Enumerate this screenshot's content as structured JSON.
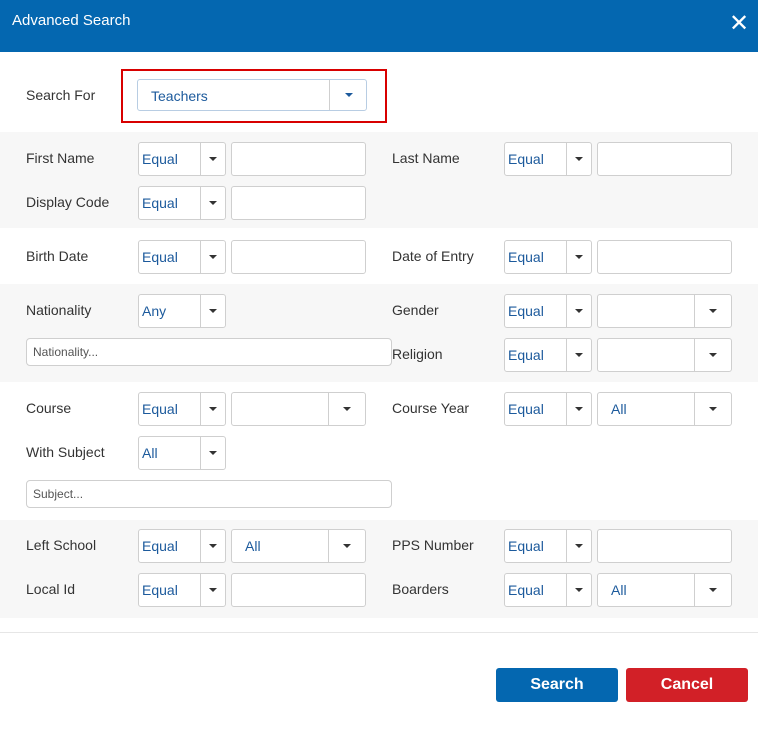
{
  "dialog": {
    "title": "Advanced Search",
    "close_glyph": "✕"
  },
  "search_for": {
    "label": "Search For",
    "value": "Teachers"
  },
  "fields": {
    "first_name": {
      "label": "First Name",
      "operator": "Equal"
    },
    "last_name": {
      "label": "Last Name",
      "operator": "Equal"
    },
    "display_code": {
      "label": "Display Code",
      "operator": "Equal"
    },
    "birth_date": {
      "label": "Birth Date",
      "operator": "Equal"
    },
    "date_of_entry": {
      "label": "Date of Entry",
      "operator": "Equal"
    },
    "nationality": {
      "label": "Nationality",
      "operator": "Any",
      "placeholder": "Nationality..."
    },
    "gender": {
      "label": "Gender",
      "operator": "Equal",
      "value": ""
    },
    "religion": {
      "label": "Religion",
      "operator": "Equal",
      "value": ""
    },
    "course": {
      "label": "Course",
      "operator": "Equal",
      "value": ""
    },
    "course_year": {
      "label": "Course Year",
      "operator": "Equal",
      "value": "All"
    },
    "with_subject": {
      "label": "With Subject",
      "operator": "All",
      "placeholder": "Subject..."
    },
    "left_school": {
      "label": "Left School",
      "operator": "Equal",
      "value": "All"
    },
    "pps_number": {
      "label": "PPS Number",
      "operator": "Equal"
    },
    "local_id": {
      "label": "Local Id",
      "operator": "Equal"
    },
    "boarders": {
      "label": "Boarders",
      "operator": "Equal",
      "value": "All"
    }
  },
  "buttons": {
    "search": "Search",
    "cancel": "Cancel"
  },
  "colors": {
    "header": "#0467b0",
    "search_button": "#0467b0",
    "cancel_button": "#d22027",
    "highlight": "#d80000",
    "select_text": "#1c5a9c"
  }
}
